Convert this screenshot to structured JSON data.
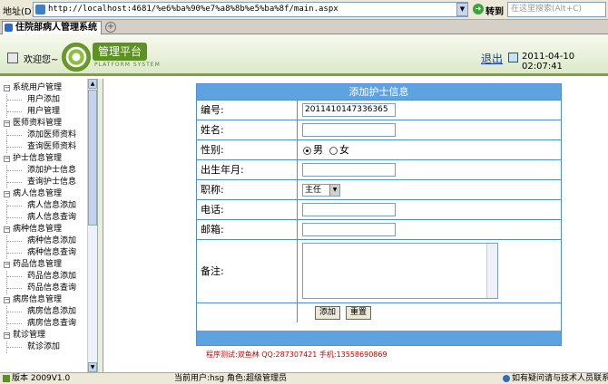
{
  "browser": {
    "address_label": "地址(D)",
    "url": "http://localhost:4681/%e6%ba%90%e7%a8%8b%e5%ba%8f/main.aspx",
    "go_label": "转到",
    "search_placeholder": "在这里搜索(Alt+C)",
    "tab_title": "住院部病人管理系统"
  },
  "header": {
    "welcome": "欢迎您~",
    "logo_text": "管理平台",
    "logo_sub": "PLATFORM SYSTEM",
    "logout": "退出",
    "datetime": "2011-04-10 02:07:41"
  },
  "sidebar": {
    "groups": [
      {
        "label": "系统用户管理",
        "items": [
          "用户添加",
          "用户管理"
        ]
      },
      {
        "label": "医师资料管理",
        "items": [
          "添加医师资料",
          "查询医师资料"
        ]
      },
      {
        "label": "护士信息管理",
        "items": [
          "添加护士信息",
          "查询护士信息"
        ]
      },
      {
        "label": "病人信息管理",
        "items": [
          "病人信息添加",
          "病人信息查询"
        ]
      },
      {
        "label": "病种信息管理",
        "items": [
          "病种信息添加",
          "病种信息查询"
        ]
      },
      {
        "label": "药品信息管理",
        "items": [
          "药品信息添加",
          "药品信息查询"
        ]
      },
      {
        "label": "病房信息管理",
        "items": [
          "病房信息添加",
          "病房信息查询"
        ]
      },
      {
        "label": "就诊管理",
        "items": [
          "就诊添加"
        ]
      }
    ]
  },
  "form": {
    "title": "添加护士信息",
    "id_label": "编号:",
    "id_value": "2011410147336365",
    "name_label": "姓名:",
    "gender_label": "性别:",
    "gender_male": "男",
    "gender_female": "女",
    "birth_label": "出生年月:",
    "title_field_label": "职称:",
    "title_field_value": "主任",
    "phone_label": "电话:",
    "email_label": "邮箱:",
    "remark_label": "备注:",
    "add_button": "添加",
    "reset_button": "重置"
  },
  "credit": "程序测试:双鱼林  QQ:287307421  手机:13558690869",
  "status": {
    "version": "版本 2009V1.0",
    "current_user": "当前用户:hsg 角色:超级管理员",
    "help": "如有疑问请与技术人员联系"
  }
}
